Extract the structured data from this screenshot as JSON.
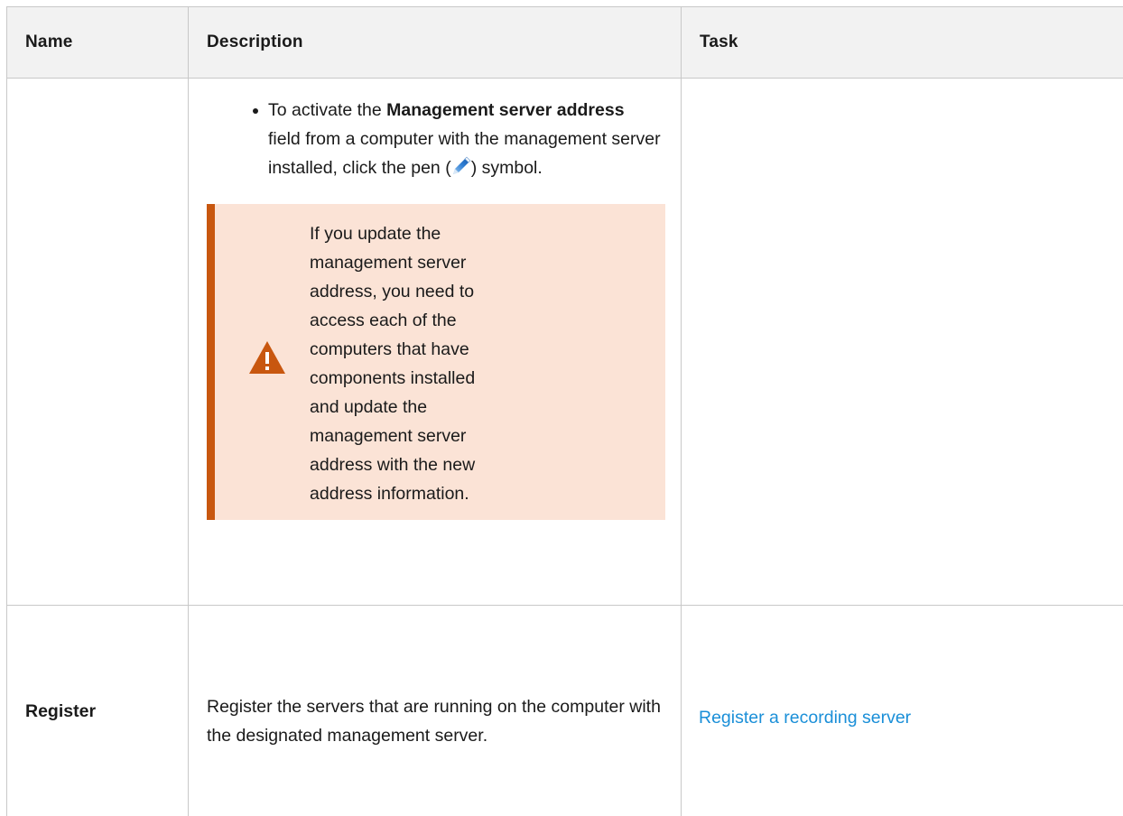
{
  "table": {
    "headers": [
      "Name",
      "Description",
      "Task"
    ],
    "row1": {
      "name": "",
      "bullet": {
        "text_before": "To activate the ",
        "bold": "Management server address",
        "text_after": " field from a computer with the management server installed, click the pen (",
        "text_end": ") symbol.",
        "icon": "pen-icon"
      },
      "warning": {
        "icon": "warning-icon",
        "text": "If you update the management server address, you need to access each of the computers that have components installed and update the management server address with the new address information."
      },
      "task": ""
    },
    "row2": {
      "name": "Register",
      "description": "Register the servers that are running on the computer with the designated management server.",
      "task_link": "Register a recording server"
    }
  },
  "colors": {
    "header_bg": "#f2f2f2",
    "border": "#c8c8c8",
    "warning_bg": "#fbe3d6",
    "warning_accent": "#c8570f",
    "link": "#1a8fd8"
  }
}
